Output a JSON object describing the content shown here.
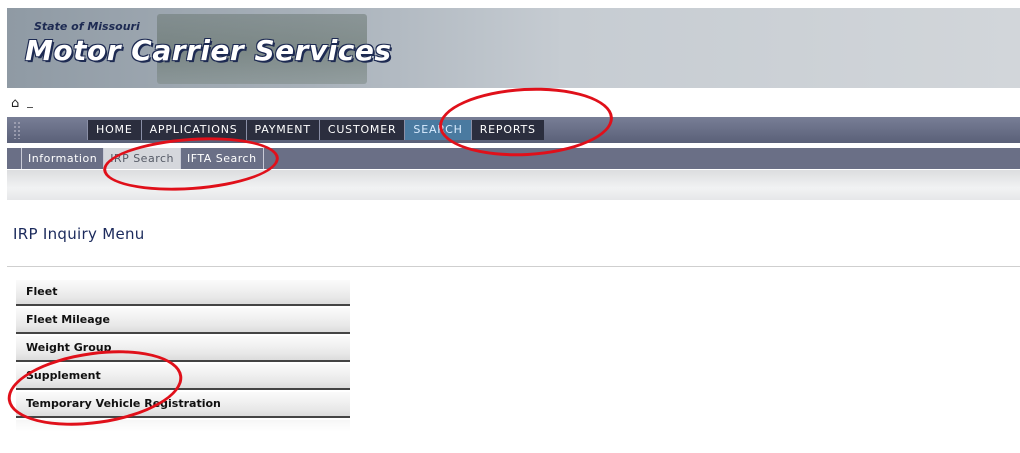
{
  "banner": {
    "state": "State of Missouri",
    "title": "Motor Carrier Services"
  },
  "home": {
    "icon": "home-icon"
  },
  "main_nav": [
    "HOME",
    "APPLICATIONS",
    "PAYMENT",
    "CUSTOMER",
    "SEARCH",
    "REPORTS"
  ],
  "main_nav_active": "SEARCH",
  "sub_nav": [
    "Information",
    "IRP Search",
    "IFTA Search"
  ],
  "sub_nav_active": "IRP Search",
  "page": {
    "title": "IRP Inquiry Menu"
  },
  "menu": [
    "Fleet",
    "Fleet Mileage",
    "Weight Group",
    "Supplement",
    "Temporary Vehicle Registration"
  ],
  "colors": {
    "annotation": "#e0101a",
    "nav_dark": "#2b2e3e",
    "nav_active": "#4a7aa0",
    "title_navy": "#1b2a5c"
  }
}
